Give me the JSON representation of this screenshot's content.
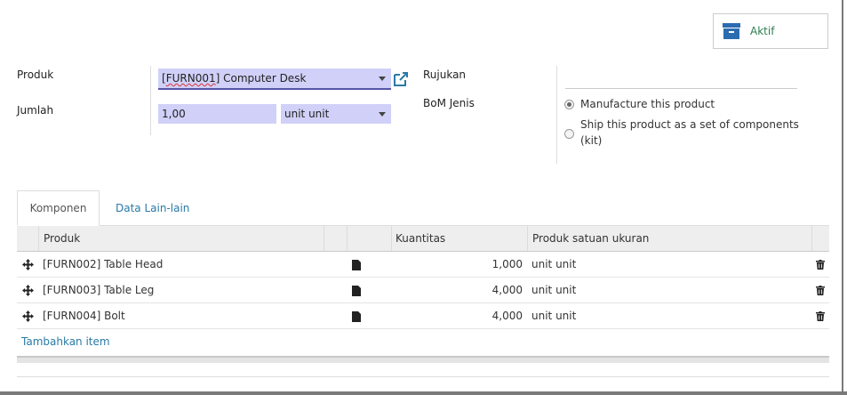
{
  "status": {
    "label": "Aktif",
    "icon": "archive-box-icon",
    "color": "#2e7d4f"
  },
  "form": {
    "product_label": "Produk",
    "product_value_code": "FURN001",
    "product_value_name": " Computer Desk",
    "quantity_label": "Jumlah",
    "quantity_value": "1,00",
    "uom_value": "unit unit",
    "reference_label": "Rujukan",
    "reference_value": "",
    "bom_type_label": "BoM Jenis",
    "bom_type_options": [
      {
        "label": "Manufacture this product",
        "checked": true
      },
      {
        "label": "Ship this product as a set of components",
        "label_line2": "(kit)",
        "checked": false
      }
    ]
  },
  "tabs": [
    {
      "label": "Komponen",
      "active": true
    },
    {
      "label": "Data Lain-lain",
      "active": false
    }
  ],
  "table": {
    "columns": [
      "Produk",
      "",
      "",
      "Kuantitas",
      "Produk satuan ukuran",
      ""
    ],
    "rows": [
      {
        "product": "[FURN002] Table Head",
        "quantity": "1,000",
        "uom": "unit unit"
      },
      {
        "product": "[FURN003] Table Leg",
        "quantity": "4,000",
        "uom": "unit unit"
      },
      {
        "product": "[FURN004] Bolt",
        "quantity": "4,000",
        "uom": "unit unit"
      }
    ],
    "add_item_label": "Tambahkan item"
  },
  "colors": {
    "accent_link": "#2a7aa6",
    "field_bg": "#d0d0f8",
    "archive_icon": "#2b6cb0"
  }
}
